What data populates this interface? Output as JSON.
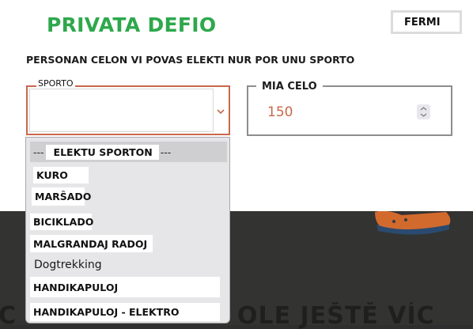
{
  "background": {
    "heading_left": "C",
    "heading_right": "OLE JEŠTĚ VÍC"
  },
  "modal": {
    "title": "PRIVATA DEFIO",
    "close_label": "FERMI",
    "instruction": "PERSONAN CELON VI POVAS ELEKTI NUR POR UNU SPORTO",
    "sport_label": "SPORTO",
    "amount_label": "MIA CELO",
    "amount_value": "150",
    "colors": {
      "title": "#2ea84c",
      "accent": "#c8684a"
    }
  },
  "dropdown": {
    "header_dash_left": "---",
    "header_label": "ELEKTU SPORTON",
    "header_dash_right": "---",
    "options": [
      "KURO",
      "MARŜADO",
      "BICIKLADO",
      "MALGRANDAJ RADOJ",
      "Dogtrekking",
      "HANDIKAPULOJ",
      "HANDIKAPULOJ - ELEKTRO"
    ]
  },
  "icons": {
    "chevron": "chevron-down-icon",
    "stepper": "number-stepper-icon",
    "shoe": "shoe-illustration"
  }
}
